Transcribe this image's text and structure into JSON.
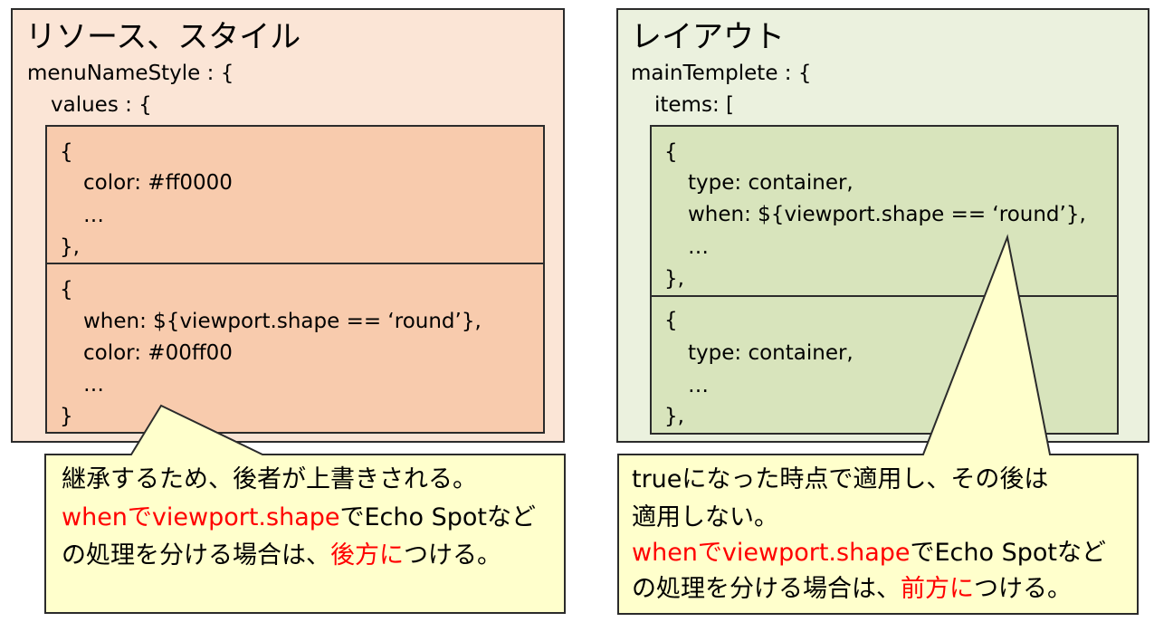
{
  "left_panel": {
    "title": "リソース、スタイル",
    "line1": "menuNameStyle : {",
    "line2": "values : {",
    "block1": [
      "{",
      "color: #ff0000",
      "…",
      "},"
    ],
    "block2": [
      "{",
      "when: ${viewport.shape == ‘round’},",
      "color: #00ff00",
      "…",
      "}"
    ]
  },
  "right_panel": {
    "title": "レイアウト",
    "line1": "mainTemplete : {",
    "line2": "items: [",
    "block1": [
      "{",
      "type: container,",
      "when: ${viewport.shape == ‘round’},",
      "…",
      "},"
    ],
    "block2": [
      "{",
      "type: container,",
      "…",
      "},"
    ]
  },
  "left_callout": {
    "line1": "継承するため、後者が上書きされる。",
    "line2_red": "whenでviewport.shape",
    "line2_rest": "でEcho Spotなど",
    "line3_start": "の処理を分ける場合は、",
    "line3_red": "後方に",
    "line3_end": "つける。"
  },
  "right_callout": {
    "line1": "trueになった時点で適用し、その後は",
    "line2": "適用しない。",
    "line3_red": "whenでviewport.shape",
    "line3_rest": "でEcho Spotなど",
    "line4_start": "の処理を分ける場合は、",
    "line4_red": "前方に",
    "line4_end": "つける。"
  },
  "colors": {
    "left_panel_bg": "#fbe5d6",
    "left_inner_bg": "#f8cbad",
    "right_panel_bg": "#ebf1de",
    "right_inner_bg": "#d8e4bc",
    "callout_bg": "#ffffcc",
    "highlight": "#ff0000"
  }
}
